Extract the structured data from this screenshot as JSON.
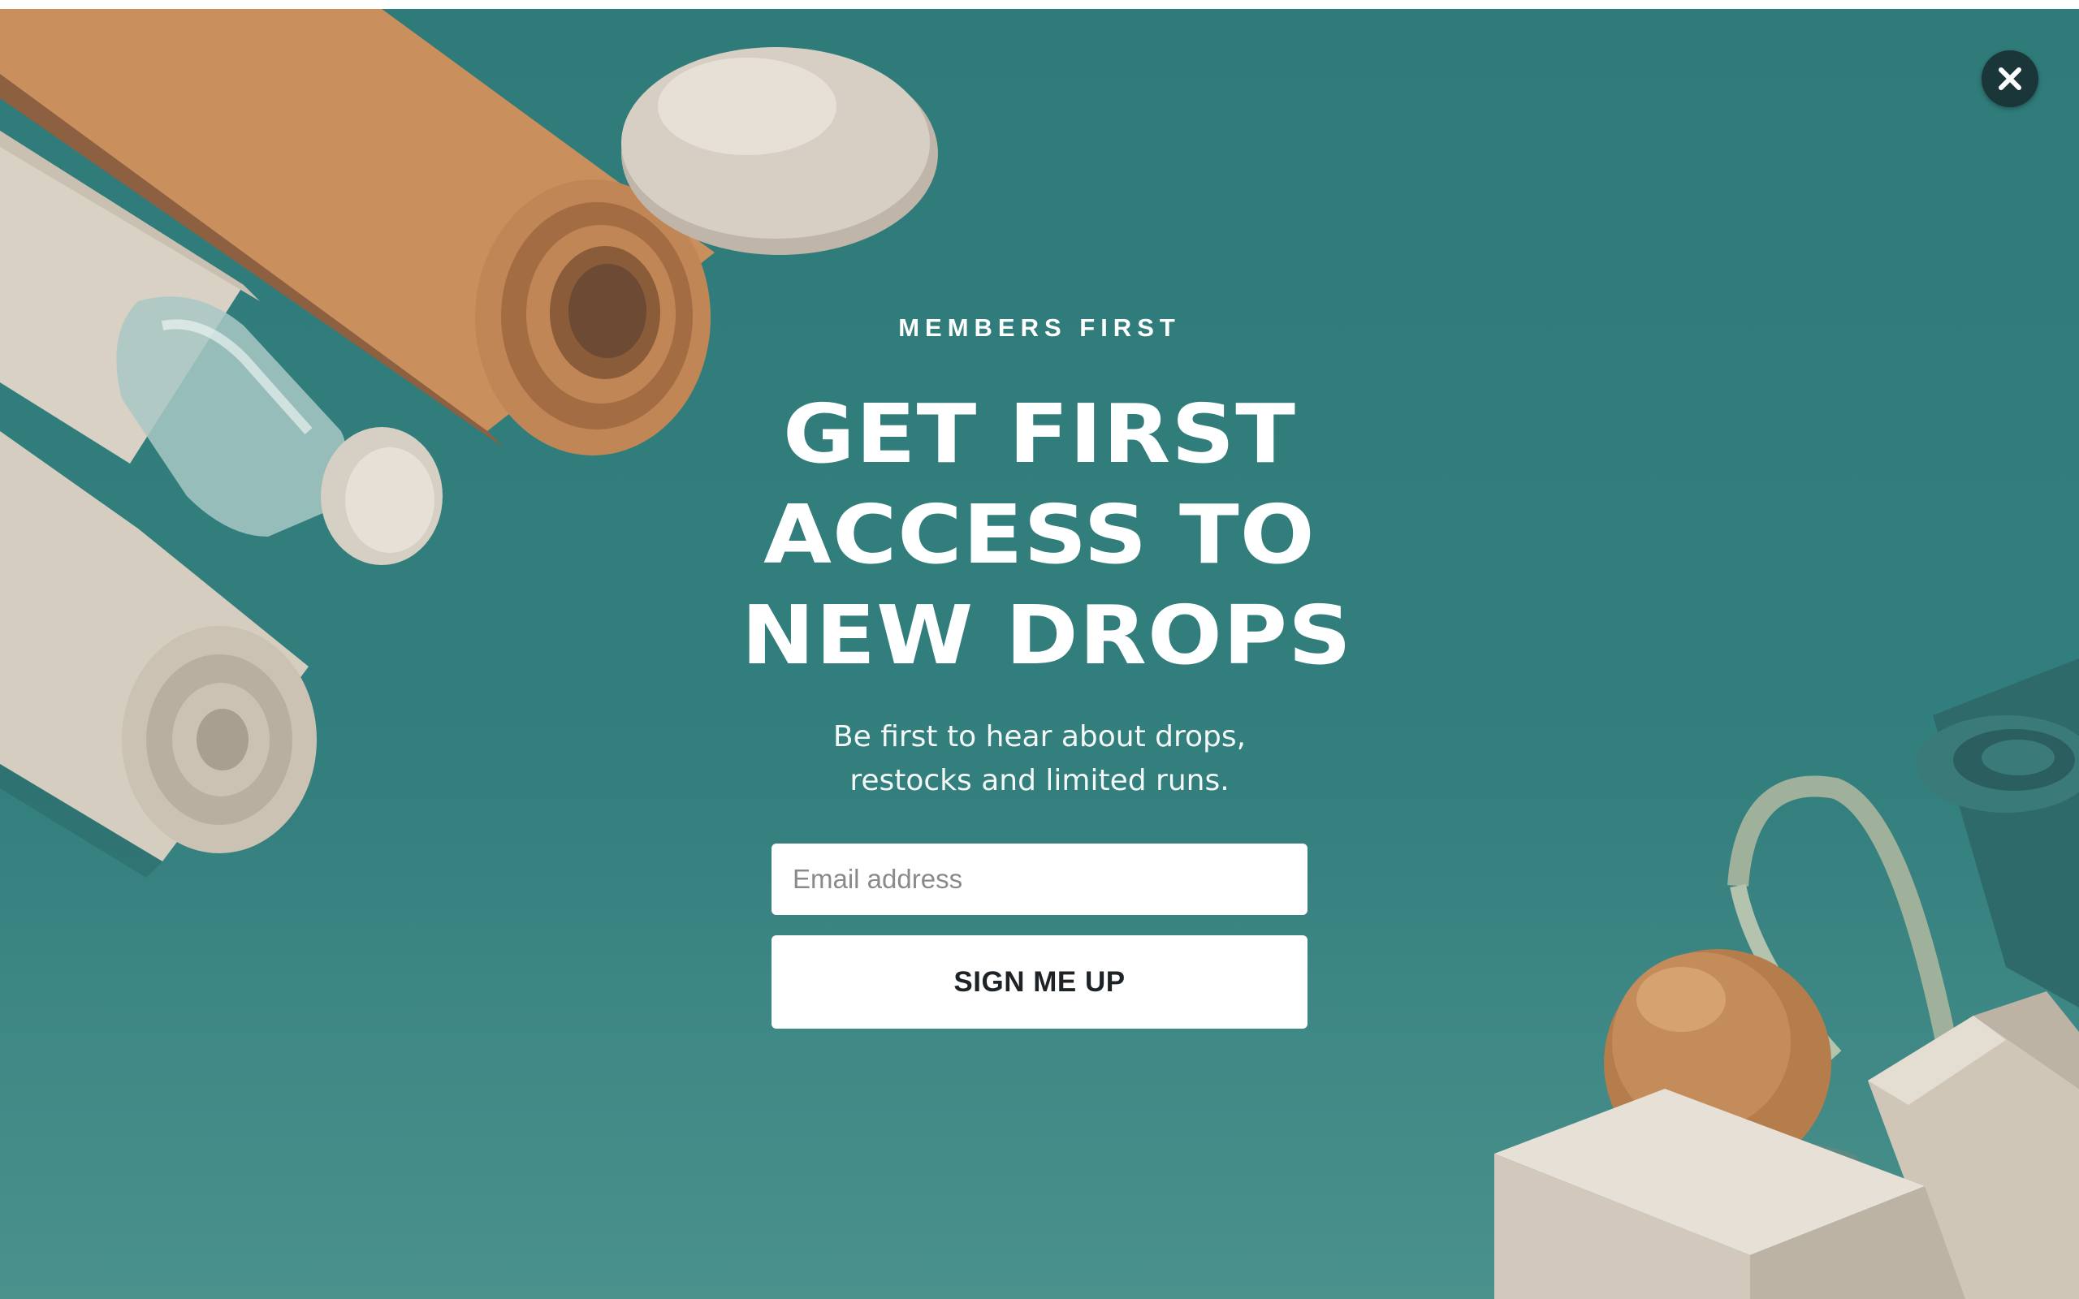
{
  "popup": {
    "eyebrow": "MEMBERS FIRST",
    "headline": [
      "GET FIRST",
      "ACCESS TO",
      "NEW DROPS"
    ],
    "subtext": [
      "Be first to hear about drops,",
      "restocks and limited runs."
    ],
    "email_placeholder": "Email address",
    "email_value": "",
    "submit_label": "SIGN ME UP",
    "close_icon": "close-icon"
  },
  "colors": {
    "background": "#307c7b",
    "close_button": "#1a3638",
    "text": "#ffffff",
    "button_text": "#1d2326"
  },
  "illustration": {
    "items": [
      "cork-yoga-mat-icon",
      "stone-icon",
      "linen-yoga-mat-icon",
      "water-bottle-icon",
      "cork-ball-icon",
      "yoga-block-icon",
      "resistance-strap-icon",
      "teal-yoga-mat-icon"
    ]
  }
}
